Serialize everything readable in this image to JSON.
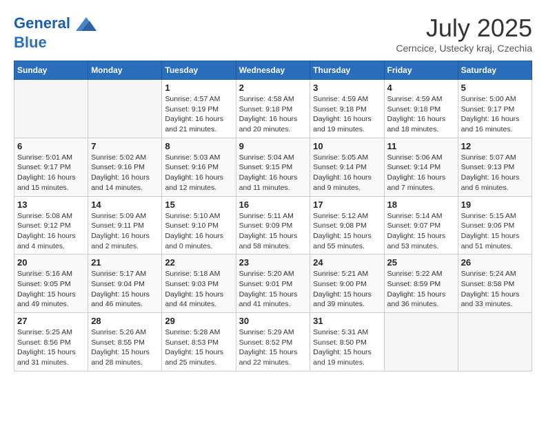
{
  "header": {
    "logo_line1": "General",
    "logo_line2": "Blue",
    "month": "July 2025",
    "location": "Cerncice, Ustecky kraj, Czechia"
  },
  "weekdays": [
    "Sunday",
    "Monday",
    "Tuesday",
    "Wednesday",
    "Thursday",
    "Friday",
    "Saturday"
  ],
  "weeks": [
    [
      {
        "day": "",
        "info": ""
      },
      {
        "day": "",
        "info": ""
      },
      {
        "day": "1",
        "info": "Sunrise: 4:57 AM\nSunset: 9:19 PM\nDaylight: 16 hours and 21 minutes."
      },
      {
        "day": "2",
        "info": "Sunrise: 4:58 AM\nSunset: 9:18 PM\nDaylight: 16 hours and 20 minutes."
      },
      {
        "day": "3",
        "info": "Sunrise: 4:59 AM\nSunset: 9:18 PM\nDaylight: 16 hours and 19 minutes."
      },
      {
        "day": "4",
        "info": "Sunrise: 4:59 AM\nSunset: 9:18 PM\nDaylight: 16 hours and 18 minutes."
      },
      {
        "day": "5",
        "info": "Sunrise: 5:00 AM\nSunset: 9:17 PM\nDaylight: 16 hours and 16 minutes."
      }
    ],
    [
      {
        "day": "6",
        "info": "Sunrise: 5:01 AM\nSunset: 9:17 PM\nDaylight: 16 hours and 15 minutes."
      },
      {
        "day": "7",
        "info": "Sunrise: 5:02 AM\nSunset: 9:16 PM\nDaylight: 16 hours and 14 minutes."
      },
      {
        "day": "8",
        "info": "Sunrise: 5:03 AM\nSunset: 9:16 PM\nDaylight: 16 hours and 12 minutes."
      },
      {
        "day": "9",
        "info": "Sunrise: 5:04 AM\nSunset: 9:15 PM\nDaylight: 16 hours and 11 minutes."
      },
      {
        "day": "10",
        "info": "Sunrise: 5:05 AM\nSunset: 9:14 PM\nDaylight: 16 hours and 9 minutes."
      },
      {
        "day": "11",
        "info": "Sunrise: 5:06 AM\nSunset: 9:14 PM\nDaylight: 16 hours and 7 minutes."
      },
      {
        "day": "12",
        "info": "Sunrise: 5:07 AM\nSunset: 9:13 PM\nDaylight: 16 hours and 6 minutes."
      }
    ],
    [
      {
        "day": "13",
        "info": "Sunrise: 5:08 AM\nSunset: 9:12 PM\nDaylight: 16 hours and 4 minutes."
      },
      {
        "day": "14",
        "info": "Sunrise: 5:09 AM\nSunset: 9:11 PM\nDaylight: 16 hours and 2 minutes."
      },
      {
        "day": "15",
        "info": "Sunrise: 5:10 AM\nSunset: 9:10 PM\nDaylight: 16 hours and 0 minutes."
      },
      {
        "day": "16",
        "info": "Sunrise: 5:11 AM\nSunset: 9:09 PM\nDaylight: 15 hours and 58 minutes."
      },
      {
        "day": "17",
        "info": "Sunrise: 5:12 AM\nSunset: 9:08 PM\nDaylight: 15 hours and 55 minutes."
      },
      {
        "day": "18",
        "info": "Sunrise: 5:14 AM\nSunset: 9:07 PM\nDaylight: 15 hours and 53 minutes."
      },
      {
        "day": "19",
        "info": "Sunrise: 5:15 AM\nSunset: 9:06 PM\nDaylight: 15 hours and 51 minutes."
      }
    ],
    [
      {
        "day": "20",
        "info": "Sunrise: 5:16 AM\nSunset: 9:05 PM\nDaylight: 15 hours and 49 minutes."
      },
      {
        "day": "21",
        "info": "Sunrise: 5:17 AM\nSunset: 9:04 PM\nDaylight: 15 hours and 46 minutes."
      },
      {
        "day": "22",
        "info": "Sunrise: 5:18 AM\nSunset: 9:03 PM\nDaylight: 15 hours and 44 minutes."
      },
      {
        "day": "23",
        "info": "Sunrise: 5:20 AM\nSunset: 9:01 PM\nDaylight: 15 hours and 41 minutes."
      },
      {
        "day": "24",
        "info": "Sunrise: 5:21 AM\nSunset: 9:00 PM\nDaylight: 15 hours and 39 minutes."
      },
      {
        "day": "25",
        "info": "Sunrise: 5:22 AM\nSunset: 8:59 PM\nDaylight: 15 hours and 36 minutes."
      },
      {
        "day": "26",
        "info": "Sunrise: 5:24 AM\nSunset: 8:58 PM\nDaylight: 15 hours and 33 minutes."
      }
    ],
    [
      {
        "day": "27",
        "info": "Sunrise: 5:25 AM\nSunset: 8:56 PM\nDaylight: 15 hours and 31 minutes."
      },
      {
        "day": "28",
        "info": "Sunrise: 5:26 AM\nSunset: 8:55 PM\nDaylight: 15 hours and 28 minutes."
      },
      {
        "day": "29",
        "info": "Sunrise: 5:28 AM\nSunset: 8:53 PM\nDaylight: 15 hours and 25 minutes."
      },
      {
        "day": "30",
        "info": "Sunrise: 5:29 AM\nSunset: 8:52 PM\nDaylight: 15 hours and 22 minutes."
      },
      {
        "day": "31",
        "info": "Sunrise: 5:31 AM\nSunset: 8:50 PM\nDaylight: 15 hours and 19 minutes."
      },
      {
        "day": "",
        "info": ""
      },
      {
        "day": "",
        "info": ""
      }
    ]
  ]
}
